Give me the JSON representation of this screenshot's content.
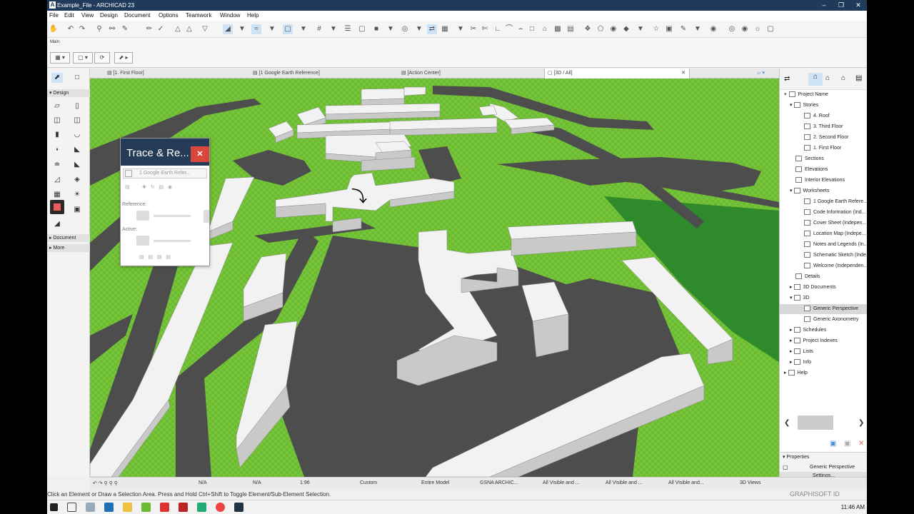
{
  "window": {
    "title": "Example_File - ARCHICAD 23",
    "icon": "archicad-logo-icon",
    "controls": [
      "minimize-icon",
      "maximize-icon",
      "close-icon"
    ]
  },
  "menus": [
    "File",
    "Edit",
    "View",
    "Design",
    "Document",
    "Options",
    "Teamwork",
    "Window",
    "Help"
  ],
  "infobox": {
    "label": "Main:"
  },
  "tabs": [
    {
      "label": "[1. First Floor]",
      "active": false
    },
    {
      "label": "[1 Google Earth Reference]",
      "active": false
    },
    {
      "label": "[Action Center]",
      "active": false
    },
    {
      "label": "[3D / All]",
      "active": true
    }
  ],
  "toolbox": {
    "sections": {
      "design": "Design",
      "document": "Document",
      "more": "More"
    }
  },
  "trace_palette": {
    "title": "Trace & Re...",
    "reference_value": "1 Google Earth Refer...",
    "reference_label": "Reference:",
    "active_label": "Active:"
  },
  "navigator": {
    "root": "Project Name",
    "items": [
      {
        "label": "Stories",
        "level": 1,
        "expanded": true
      },
      {
        "label": "4. Roof",
        "level": 2
      },
      {
        "label": "3. Third Floor",
        "level": 2
      },
      {
        "label": "2. Second Floor",
        "level": 2
      },
      {
        "label": "1. First Floor",
        "level": 2
      },
      {
        "label": "Sections",
        "level": 1
      },
      {
        "label": "Elevations",
        "level": 1
      },
      {
        "label": "Interior Elevations",
        "level": 1
      },
      {
        "label": "Worksheets",
        "level": 1,
        "expanded": true
      },
      {
        "label": "1 Google Earth Refere...",
        "level": 2
      },
      {
        "label": "Code Information (Ind...",
        "level": 2
      },
      {
        "label": "Cover Sheet (Indepen...",
        "level": 2
      },
      {
        "label": "Location Map (Indepe...",
        "level": 2
      },
      {
        "label": "Notes and Legends (In...",
        "level": 2
      },
      {
        "label": "Schematic Sketch (Inde...",
        "level": 2
      },
      {
        "label": "Welcome (Independen...",
        "level": 2
      },
      {
        "label": "Details",
        "level": 1
      },
      {
        "label": "3D Documents",
        "level": 1,
        "collapsed": true
      },
      {
        "label": "3D",
        "level": 1,
        "expanded": true
      },
      {
        "label": "Generic Perspective",
        "level": 2,
        "selected": true
      },
      {
        "label": "Generic Axonometry",
        "level": 2
      },
      {
        "label": "Schedules",
        "level": 1,
        "collapsed": true
      },
      {
        "label": "Project Indexes",
        "level": 1,
        "collapsed": true
      },
      {
        "label": "Lists",
        "level": 1,
        "collapsed": true
      },
      {
        "label": "Info",
        "level": 1,
        "collapsed": true
      },
      {
        "label": "Help",
        "level": 0,
        "collapsed": true
      }
    ]
  },
  "properties": {
    "header": "Properties",
    "value": "Generic Perspective",
    "settings": "Settings..."
  },
  "statusbar": {
    "na1": "N/A",
    "na2": "N/A",
    "scale": "1:96",
    "custom": "Custom",
    "model": "Entire Model",
    "layer": "GSNA ARCHIC...",
    "vis1": "All Visible and ...",
    "vis2": "All Visible and ...",
    "vis3": "All Visible and...",
    "views": "3D Views"
  },
  "hint": "Click an Element or Draw a Selection Area. Press and Hold Ctrl+Shift to Toggle Element/Sub-Element Selection.",
  "brand": "GRAPHISOFT ID",
  "taskbar": {
    "clock": "11:46 AM"
  },
  "colors": {
    "grass": "#6cba32",
    "road": "#4d4d4d",
    "building_top": "#f2f2f2",
    "building_side": "#c9c9c9",
    "title_bar": "#243c58",
    "close_red": "#d9463b"
  }
}
